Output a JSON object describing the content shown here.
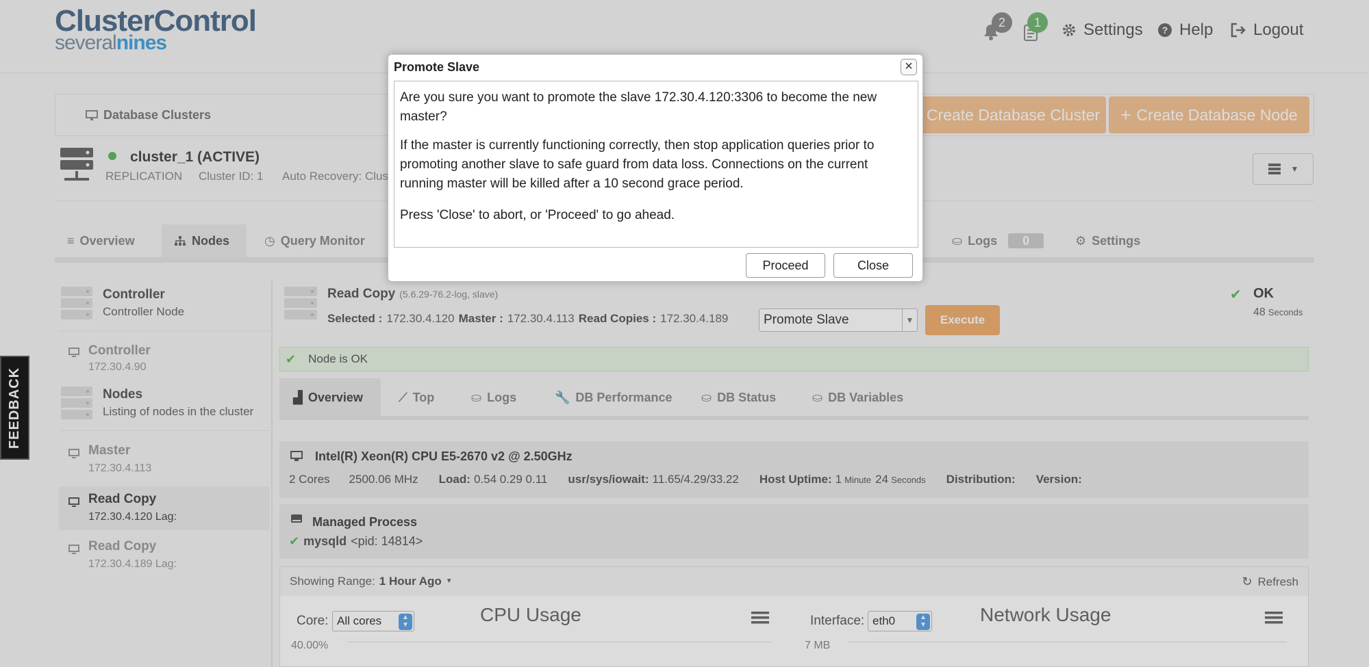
{
  "header": {
    "logo_top": "ClusterControl",
    "logo_bottom_prefix": "several",
    "logo_bottom_brand": "nines",
    "notifications_count": "2",
    "jobs_count": "1",
    "settings_label": "Settings",
    "help_label": "Help",
    "logout_label": "Logout"
  },
  "toolbar": {
    "breadcrumb": "Database Clusters",
    "create_cluster_label": "Create Database Cluster",
    "create_node_label": "Create Database Node"
  },
  "cluster": {
    "name": "cluster_1 (ACTIVE)",
    "type": "REPLICATION",
    "cluster_id": "Cluster ID: 1",
    "auto_recovery": "Auto Recovery: Clus"
  },
  "tabs": {
    "overview": "Overview",
    "nodes": "Nodes",
    "query_monitor": "Query Monitor",
    "logs": "Logs",
    "logs_count": "0",
    "settings": "Settings"
  },
  "sidebar": {
    "controller_group_title": "Controller",
    "controller_group_sub": "Controller Node",
    "controller_name": "Controller",
    "controller_ip": "172.30.4.90",
    "nodes_group_title": "Nodes",
    "nodes_group_sub": "Listing of nodes in the cluster",
    "master_name": "Master",
    "master_ip": "172.30.4.113",
    "rc1_name": "Read Copy",
    "rc1_ip": "172.30.4.120 Lag:",
    "rc2_name": "Read Copy",
    "rc2_ip": "172.30.4.189 Lag:"
  },
  "node": {
    "title": "Read Copy",
    "version": "(5.6.29-76.2-log, slave)",
    "selected_label": "Selected :",
    "selected_value": "172.30.4.120",
    "master_label": "Master :",
    "master_value": "172.30.4.113",
    "read_copies_label": "Read Copies :",
    "read_copies_value": "172.30.4.189",
    "action_select": "Promote Slave",
    "execute_label": "Execute",
    "status": "OK",
    "status_time_value": "48",
    "status_time_unit": "Seconds",
    "ok_message": "Node is OK"
  },
  "subtabs": {
    "overview": "Overview",
    "top": "Top",
    "logs": "Logs",
    "db_performance": "DB Performance",
    "db_status": "DB Status",
    "db_variables": "DB Variables"
  },
  "host": {
    "cpu": "Intel(R) Xeon(R) CPU E5-2670 v2 @ 2.50GHz",
    "cores": "2 Cores",
    "mhz": "2500.06 MHz",
    "load_label": "Load:",
    "load_value": "0.54 0.29 0.11",
    "iowait_label": "usr/sys/iowait:",
    "iowait_value": "11.65/4.29/33.22",
    "uptime_label": "Host Uptime:",
    "uptime_min_value": "1",
    "uptime_min_unit": "Minute",
    "uptime_sec_value": "24",
    "uptime_sec_unit": "Seconds",
    "distribution_label": "Distribution:",
    "version_label": "Version:"
  },
  "process": {
    "title": "Managed Process",
    "name": "mysqld",
    "pid": "<pid: 14814>"
  },
  "charts": {
    "range_label": "Showing Range:",
    "range_value": "1 Hour Ago",
    "refresh_label": "Refresh",
    "core_label": "Core:",
    "core_value": "All cores",
    "cpu_title": "CPU Usage",
    "cpu_axis": "40.00%",
    "interface_label": "Interface:",
    "interface_value": "eth0",
    "net_title": "Network Usage",
    "net_axis": "7 MB"
  },
  "feedback_label": "FEEDBACK",
  "modal": {
    "title": "Promote Slave",
    "p1": "Are you sure you want to promote the slave 172.30.4.120:3306 to become the new master?",
    "p2": "If the master is currently functioning correctly, then stop application queries prior to promoting another slave to safe guard from data loss. Connections on the current running master will be killed after a 10 second grace period.",
    "p3": "Press 'Close' to abort, or 'Proceed' to go ahead.",
    "proceed_label": "Proceed",
    "close_label": "Close"
  },
  "colors": {
    "accent_orange": "#f0a860",
    "ok_green": "#5cb85c",
    "brand_blue": "#4b6a8a"
  }
}
